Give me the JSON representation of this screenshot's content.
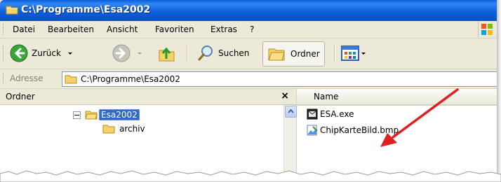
{
  "window": {
    "title": "C:\\Programme\\Esa2002"
  },
  "menu": [
    "Datei",
    "Bearbeiten",
    "Ansicht",
    "Favoriten",
    "Extras",
    "?"
  ],
  "toolbar": {
    "back_label": "Zurück",
    "search_label": "Suchen",
    "folders_label": "Ordner"
  },
  "address": {
    "label": "Adresse",
    "value": "C:\\Programme\\Esa2002"
  },
  "folders_pane": {
    "header": "Ordner",
    "close_glyph": "×",
    "items": [
      {
        "label": "Esa2002",
        "selected": true
      },
      {
        "label": "archiv",
        "selected": false
      }
    ]
  },
  "files_pane": {
    "column_name": "Name",
    "files": [
      {
        "name": "ESA.exe",
        "icon": "exe-icon"
      },
      {
        "name": "ChipKarteBild.bmp",
        "icon": "bitmap-icon"
      }
    ]
  },
  "colors": {
    "titlebar": "#0a5fd8",
    "selection": "#316ac5",
    "annotation_arrow": "#e02020"
  }
}
